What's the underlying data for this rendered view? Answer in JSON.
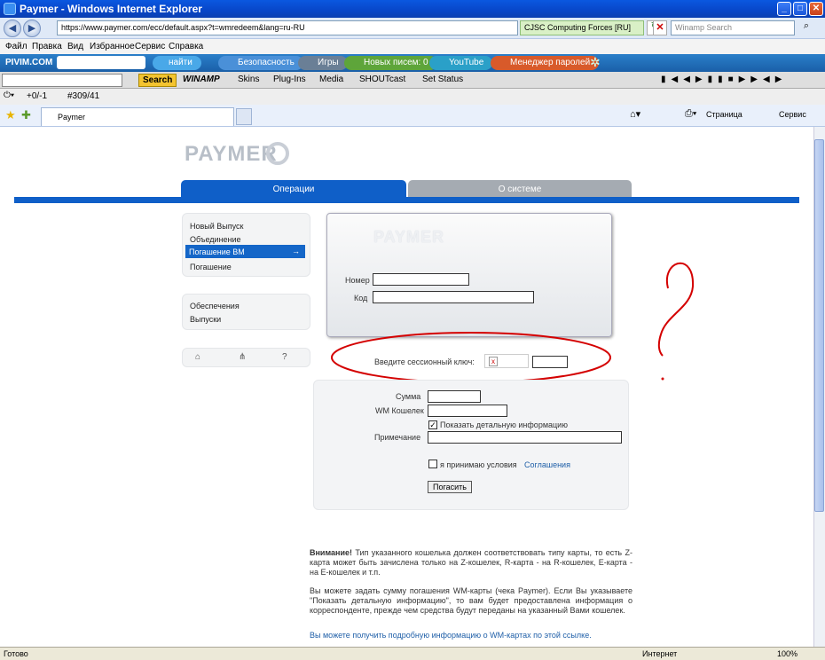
{
  "window": {
    "title": "Paymer - Windows Internet Explorer"
  },
  "address": {
    "url": "https://www.paymer.com/ecc/default.aspx?t=wmredeem&lang=ru-RU",
    "cert": "CJSC Computing Forces [RU]",
    "search_placeholder": "Winamp Search"
  },
  "menu": [
    "Файл",
    "Правка",
    "Вид",
    "Избранное",
    "Сервис",
    "Справка"
  ],
  "pivim": {
    "brand": "PIVIM.COM",
    "find": "найти",
    "security": "Безопасность",
    "games": "Игры",
    "mail": "Новых писем: 0",
    "youtube": "YouTube",
    "passwords": "Менеджер паролей"
  },
  "winamp": {
    "search_btn": "Search",
    "brand": "WINAMP",
    "skins": "Skins",
    "plugins": "Plug-Ins",
    "media": "Media",
    "shoutcast": "SHOUTcast",
    "status": "Set Status"
  },
  "row5": {
    "counter": "+0/-1",
    "number": "#309/41"
  },
  "tab": {
    "title": "Paymer",
    "page_menu": "Страница",
    "service_menu": "Сервис"
  },
  "page": {
    "logo": "PAYMER",
    "tabs": [
      "Операции",
      "О системе"
    ],
    "sidebar1": [
      "Новый Выпуск",
      "Объединение",
      "Погашение ВМ",
      "Погашение"
    ],
    "active_arrow": "→",
    "sidebar2": [
      "Обеспечения",
      "Выпуски"
    ],
    "icons_help": "?",
    "login_logo": "PAYMER",
    "number_label": "Номер",
    "code_label": "Код",
    "session_label": "Введите сессионный ключ:",
    "captcha_x": "x",
    "form": {
      "sum": "Сумма",
      "wallet": "WM Кошелек",
      "details": "Показать детальную информацию",
      "comment": "Примечание",
      "accept": "я принимаю условия",
      "agreement": "Соглашения",
      "submit": "Погасить"
    },
    "note1_bold": "Внимание!",
    "note1": "Тип указанного кошелька должен соответствовать типу карты, то есть Z-карта может быть зачислена только на Z-кошелек, R-карта - на R-кошелек, E-карта - на E-кошелек и т.п.",
    "note2": "Вы можете задать сумму погашения WM-карты (чека Paymer). Если Вы указываете \"Показать детальную информацию\", то вам будет предоставлена информация о корреспонденте, прежде чем средства будут переданы на указанный Вами кошелек.",
    "note3": "Вы можете получить подробную информацию о WM-картах по этой ссылке."
  },
  "status": {
    "left": "Готово",
    "zone": "Интернет",
    "zoom": "100%"
  },
  "colors": {
    "accent": "#0f5fc8",
    "annotation": "#d40000"
  }
}
